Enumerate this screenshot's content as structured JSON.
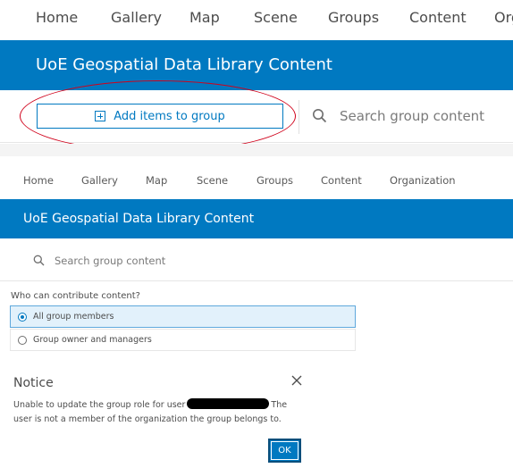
{
  "top_nav": {
    "items": [
      "Home",
      "Gallery",
      "Map",
      "Scene",
      "Groups",
      "Content",
      "Org"
    ]
  },
  "top_banner": {
    "title": "UoE Geospatial Data Library Content"
  },
  "top_toolbar": {
    "add_items_label": "Add items to group",
    "search_placeholder": "Search group content",
    "annotation_color": "#d0021b"
  },
  "nav": {
    "items": [
      "Home",
      "Gallery",
      "Map",
      "Scene",
      "Groups",
      "Content",
      "Organization"
    ]
  },
  "banner": {
    "title": "UoE Geospatial Data Library Content"
  },
  "toolbar": {
    "search_placeholder": "Search group content"
  },
  "contribute": {
    "label": "Who can contribute content?",
    "options": [
      {
        "label": "All group members",
        "selected": true
      },
      {
        "label": "Group owner and managers",
        "selected": false
      }
    ]
  },
  "notice": {
    "title": "Notice",
    "message_before": "Unable to update the group role for user",
    "message_after": "The user is not a member of the organization the group belongs to.",
    "ok_label": "OK"
  },
  "colors": {
    "brand_blue": "#0079c1",
    "redaction": "#000000"
  },
  "icons": {
    "add": "add-square-icon",
    "search": "search-icon",
    "close": "close-icon",
    "radio": "radio-icon"
  }
}
